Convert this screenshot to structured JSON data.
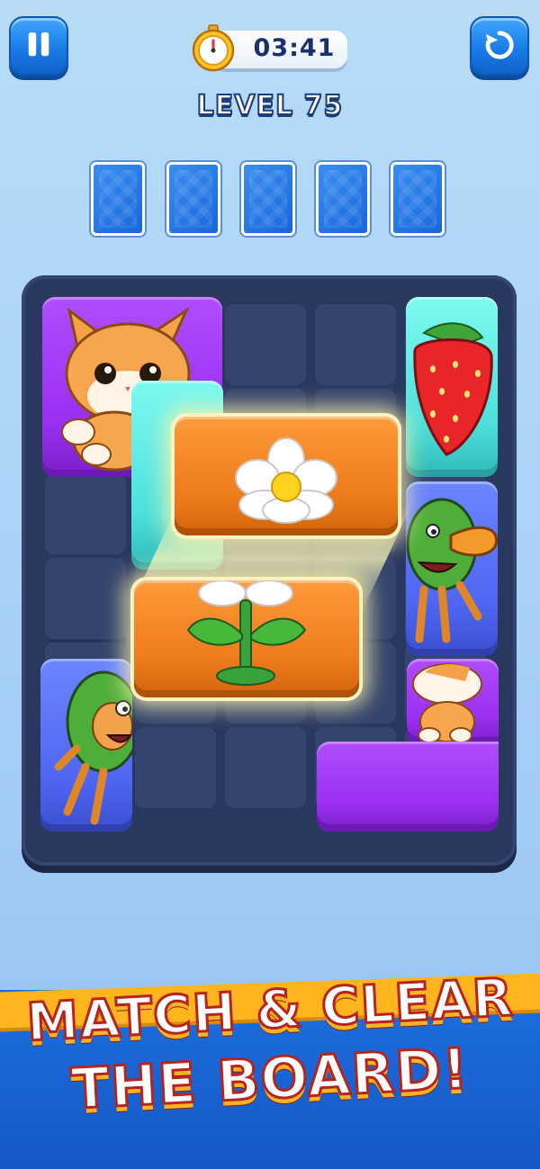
{
  "hud": {
    "timer": "03:41",
    "level": "LEVEL 75",
    "pause_icon": "pause-icon",
    "restart_icon": "restart-icon",
    "stopwatch_icon": "stopwatch-icon"
  },
  "slots": {
    "count": 5,
    "filled": 0
  },
  "tiles": [
    {
      "name": "tile-cat-top",
      "color": "purple",
      "icon": "cat"
    },
    {
      "name": "tile-strawberry",
      "color": "cyan",
      "icon": "strawberry"
    },
    {
      "name": "tile-cyan-hidden",
      "color": "cyan",
      "icon": "hidden"
    },
    {
      "name": "tile-flower-top",
      "color": "orange",
      "icon": "flower-petals"
    },
    {
      "name": "tile-flower-bottom",
      "color": "orange",
      "icon": "flower-stem"
    },
    {
      "name": "tile-duck-monster",
      "color": "blue",
      "icon": "duck-monster"
    },
    {
      "name": "tile-monster",
      "color": "blue",
      "icon": "monster"
    },
    {
      "name": "tile-cat-bottom",
      "color": "purple",
      "icon": "cat"
    }
  ],
  "colors": {
    "purple": "#9a2ff0",
    "cyan": "#4ee0dd",
    "blue": "#4e66f2",
    "orange": "#ec7a1a",
    "board": "#2a3860"
  },
  "banner": {
    "line1": "MATCH & CLEAR",
    "line2": "THE BOARD!"
  }
}
